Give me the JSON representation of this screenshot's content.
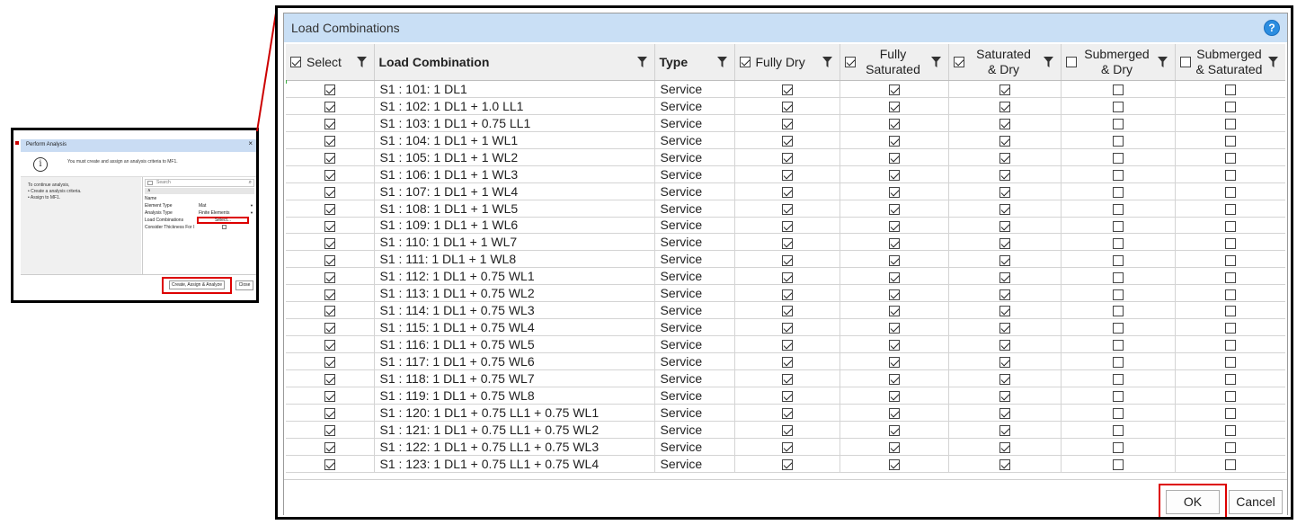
{
  "inset": {
    "title": "Perform Analysis",
    "close_glyph": "×",
    "message": "You must create and assign an analysis criteria to MF1.",
    "left_lines": [
      "To continue analysis,",
      "• Create a analysis criteria.",
      "• Assign to MF1."
    ],
    "search_placeholder": "Search",
    "group_header": "∧",
    "rows": [
      {
        "label": "Name",
        "value": ""
      },
      {
        "label": "Element Type",
        "value": "Mat"
      },
      {
        "label": "Analysis Type",
        "value": "Finite Elements"
      },
      {
        "label": "Load Combinations",
        "value": "Select..."
      },
      {
        "label": "Consider Thickness For I",
        "value": ""
      }
    ],
    "create_button": "Create, Assign & Analyze",
    "close_button": "Close"
  },
  "dialog": {
    "title": "Load Combinations",
    "help_glyph": "?",
    "columns": [
      {
        "label": "Select",
        "checkbox": true,
        "checked": true
      },
      {
        "label": "Load Combination",
        "checkbox": false
      },
      {
        "label": "Type",
        "checkbox": false
      },
      {
        "label": "Fully Dry",
        "checkbox": true,
        "checked": true
      },
      {
        "label": "Fully Saturated",
        "line1": "Fully",
        "line2": "Saturated",
        "checkbox": true,
        "checked": true
      },
      {
        "label": "Saturated & Dry",
        "line1": "Saturated",
        "line2": "& Dry",
        "checkbox": true,
        "checked": true
      },
      {
        "label": "Submerged & Dry",
        "line1": "Submerged",
        "line2": "& Dry",
        "checkbox": true,
        "checked": false
      },
      {
        "label": "Submerged & Saturated",
        "line1": "Submerged",
        "line2": "& Saturated",
        "checkbox": true,
        "checked": false
      }
    ],
    "rows": [
      {
        "name": "S1 : 101: 1 DL1",
        "type": "Service"
      },
      {
        "name": "S1 : 102: 1 DL1 + 1.0 LL1",
        "type": "Service"
      },
      {
        "name": "S1 : 103: 1 DL1 + 0.75 LL1",
        "type": "Service"
      },
      {
        "name": "S1 : 104: 1 DL1 + 1 WL1",
        "type": "Service"
      },
      {
        "name": "S1 : 105: 1 DL1 + 1 WL2",
        "type": "Service"
      },
      {
        "name": "S1 : 106: 1 DL1 + 1 WL3",
        "type": "Service"
      },
      {
        "name": "S1 : 107: 1 DL1 + 1 WL4",
        "type": "Service"
      },
      {
        "name": "S1 : 108: 1 DL1 + 1 WL5",
        "type": "Service"
      },
      {
        "name": "S1 : 109: 1 DL1 + 1 WL6",
        "type": "Service"
      },
      {
        "name": "S1 : 110: 1 DL1 + 1 WL7",
        "type": "Service"
      },
      {
        "name": "S1 : 111: 1 DL1 + 1 WL8",
        "type": "Service"
      },
      {
        "name": "S1 : 112: 1 DL1 + 0.75 WL1",
        "type": "Service"
      },
      {
        "name": "S1 : 113: 1 DL1 + 0.75 WL2",
        "type": "Service"
      },
      {
        "name": "S1 : 114: 1 DL1 + 0.75 WL3",
        "type": "Service"
      },
      {
        "name": "S1 : 115: 1 DL1 + 0.75 WL4",
        "type": "Service"
      },
      {
        "name": "S1 : 116: 1 DL1 + 0.75 WL5",
        "type": "Service"
      },
      {
        "name": "S1 : 117: 1 DL1 + 0.75 WL6",
        "type": "Service"
      },
      {
        "name": "S1 : 118: 1 DL1 + 0.75 WL7",
        "type": "Service"
      },
      {
        "name": "S1 : 119: 1 DL1 + 0.75 WL8",
        "type": "Service"
      },
      {
        "name": "S1 : 120: 1 DL1 + 0.75 LL1 + 0.75 WL1",
        "type": "Service"
      },
      {
        "name": "S1 : 121: 1 DL1 + 0.75 LL1 + 0.75 WL2",
        "type": "Service"
      },
      {
        "name": "S1 : 122: 1 DL1 + 0.75 LL1 + 0.75 WL3",
        "type": "Service"
      },
      {
        "name": "S1 : 123: 1 DL1 + 0.75 LL1 + 0.75 WL4",
        "type": "Service"
      }
    ],
    "row_checks": {
      "select": true,
      "fully_dry": true,
      "fully_saturated": true,
      "saturated_dry": true,
      "submerged_dry": false,
      "submerged_saturated": false
    },
    "ok_button": "OK",
    "cancel_button": "Cancel"
  },
  "colors": {
    "highlight": "#dd0000",
    "titlebar": "#c9dff5",
    "help": "#2b8de0"
  },
  "icons": [
    "info-icon",
    "close-icon",
    "search-icon",
    "help-icon",
    "filter-icon",
    "checkbox-icon"
  ]
}
